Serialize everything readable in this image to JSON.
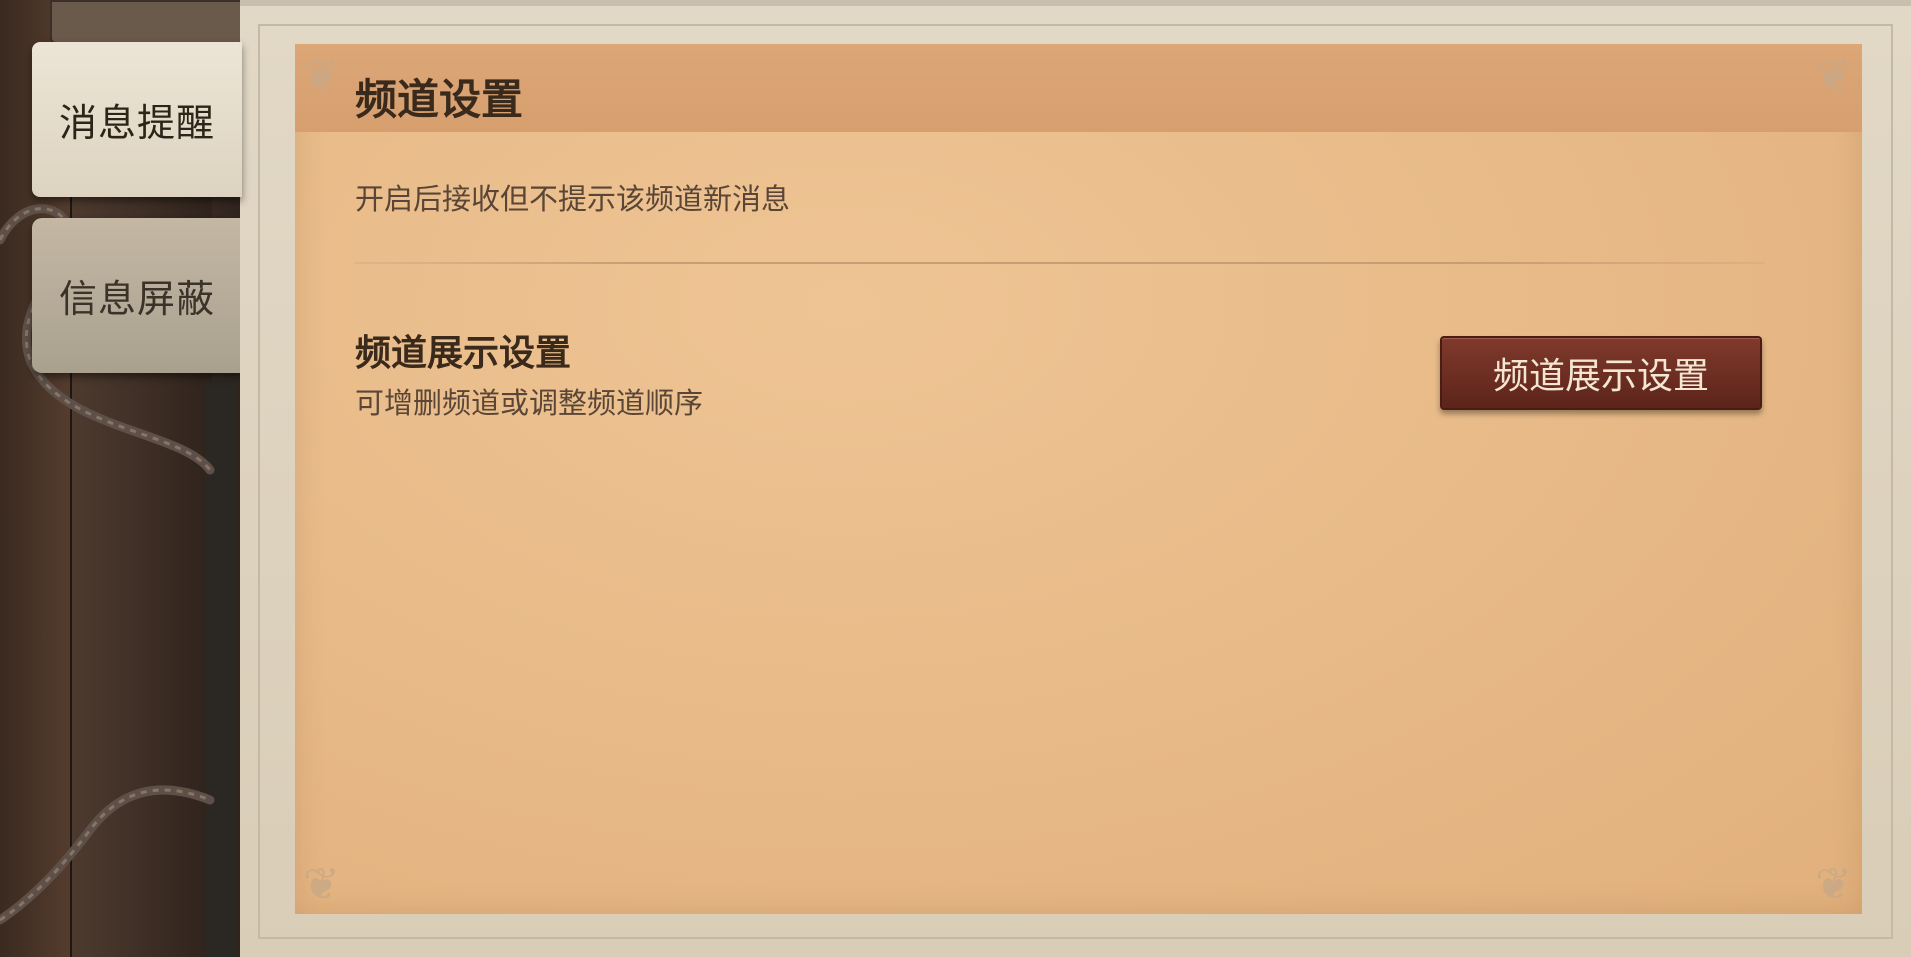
{
  "tabs": [
    {
      "label": "消息提醒",
      "active": true
    },
    {
      "label": "信息屏蔽",
      "active": false
    }
  ],
  "panel": {
    "title": "频道设置",
    "hint": "开启后接收但不提示该频道新消息",
    "row": {
      "title": "频道展示设置",
      "description": "可增删频道或调整频道顺序",
      "button_label": "频道展示设置"
    }
  },
  "colors": {
    "paper": "#e9bc8a",
    "header_band": "#d79f6e",
    "button": "#6b2c21",
    "button_text": "#f3e6d3",
    "text_dark": "#3a2a1c",
    "text_muted": "#5a4636"
  },
  "icons": [
    "corner-ornament-icon"
  ]
}
